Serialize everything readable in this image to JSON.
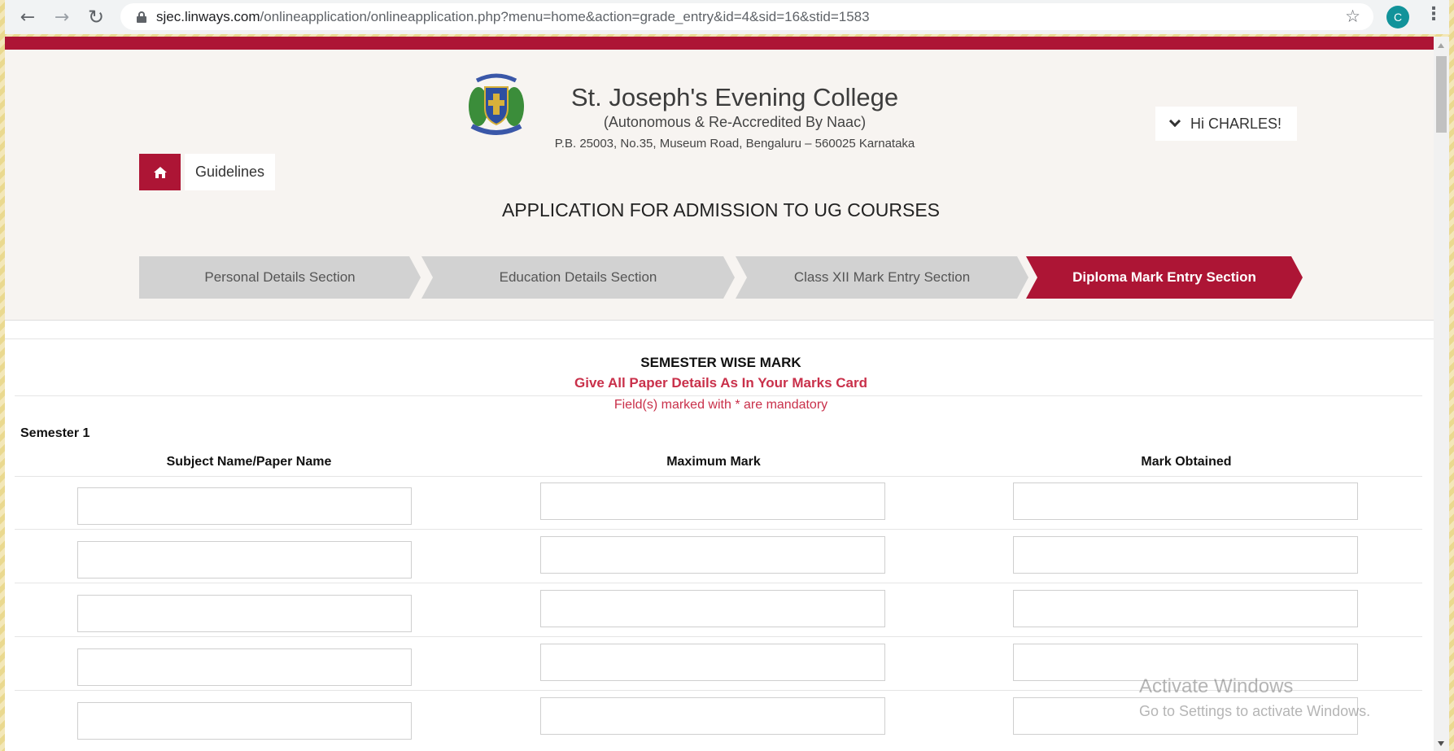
{
  "browser": {
    "url_host": "sjec.linways.com",
    "url_path": "/onlineapplication/onlineapplication.php?menu=home&action=grade_entry&id=4&sid=16&stid=1583",
    "profile_initial": "C"
  },
  "header": {
    "college_name": "St. Joseph's Evening College",
    "college_subtitle": "(Autonomous & Re-Accredited By Naac)",
    "college_address": "P.B. 25003, No.35, Museum Road, Bengaluru – 560025 Karnataka",
    "user_greeting": "Hi CHARLES!",
    "guidelines_label": "Guidelines",
    "app_title": "APPLICATION FOR ADMISSION TO UG COURSES"
  },
  "steps": [
    {
      "label": "Personal Details Section",
      "active": false
    },
    {
      "label": "Education Details Section",
      "active": false
    },
    {
      "label": "Class XII Mark Entry Section",
      "active": false
    },
    {
      "label": "Diploma Mark Entry Section",
      "active": true
    }
  ],
  "form": {
    "section_title": "SEMESTER WISE MARK",
    "section_note": "Give All Paper Details As In Your Marks Card",
    "mandatory_note": "Field(s) marked with * are mandatory",
    "semester_label": "Semester 1",
    "columns": [
      "Subject Name/Paper Name",
      "Maximum Mark",
      "Mark Obtained"
    ],
    "rows": [
      {
        "subject": "",
        "max_mark": "",
        "obtained": ""
      },
      {
        "subject": "",
        "max_mark": "",
        "obtained": ""
      },
      {
        "subject": "",
        "max_mark": "",
        "obtained": ""
      },
      {
        "subject": "",
        "max_mark": "",
        "obtained": ""
      },
      {
        "subject": "",
        "max_mark": "",
        "obtained": ""
      }
    ]
  },
  "watermark": {
    "line1": "Activate Windows",
    "line2": "Go to Settings to activate Windows."
  },
  "colors": {
    "brand": "#ad1535",
    "note_red": "#c9304a",
    "step_inactive": "#d2d2d2"
  }
}
